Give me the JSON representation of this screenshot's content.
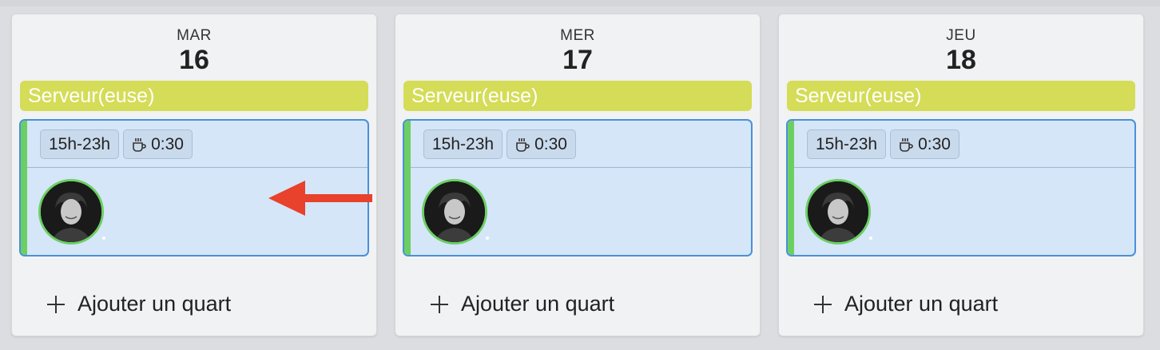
{
  "days": [
    {
      "day_name": "MAR",
      "day_number": "16",
      "role": "Serveur(euse)",
      "shift_time": "15h-23h",
      "break_time": "0:30",
      "add_label": "Ajouter un quart"
    },
    {
      "day_name": "MER",
      "day_number": "17",
      "role": "Serveur(euse)",
      "shift_time": "15h-23h",
      "break_time": "0:30",
      "add_label": "Ajouter un quart"
    },
    {
      "day_name": "JEU",
      "day_number": "18",
      "role": "Serveur(euse)",
      "shift_time": "15h-23h",
      "break_time": "0:30",
      "add_label": "Ajouter un quart"
    }
  ],
  "colors": {
    "role_bar": "#d5dc57",
    "shift_card": "#d5e6f8",
    "shift_border": "#4a90d9",
    "accent": "#6ccf64",
    "arrow": "#e8412c"
  },
  "icons": {
    "break": "coffee-cup-icon",
    "add": "plus-icon",
    "annotation": "red-arrow-left"
  }
}
